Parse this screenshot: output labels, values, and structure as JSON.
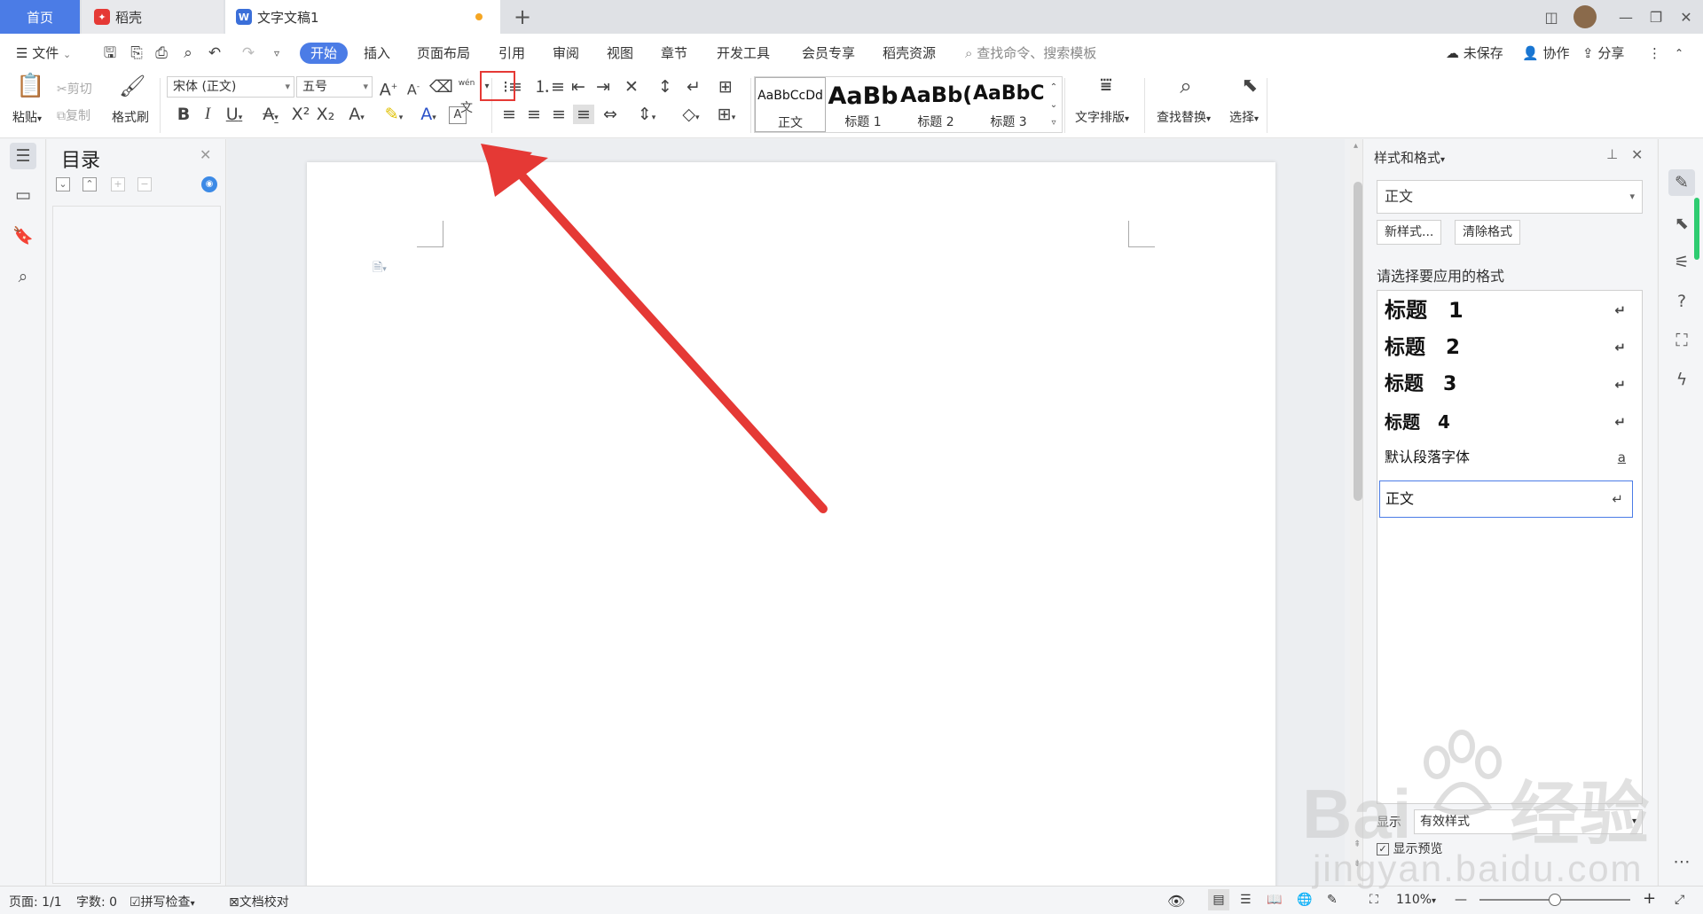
{
  "tabs": {
    "home": "首页",
    "daoke": "稻壳",
    "doc": "文字文稿1"
  },
  "menu": {
    "file": "文件",
    "items": [
      "开始",
      "插入",
      "页面布局",
      "引用",
      "审阅",
      "视图",
      "章节",
      "开发工具",
      "会员专享",
      "稻壳资源"
    ],
    "search": "查找命令、搜索模板",
    "unsaved": "未保存",
    "collab": "协作",
    "share": "分享"
  },
  "ribbon": {
    "paste": "粘贴",
    "cut": "剪切",
    "copy": "复制",
    "format_painter": "格式刷",
    "font_name": "宋体 (正文)",
    "font_size": "五号",
    "styles": [
      {
        "sample": "AaBbCcDd",
        "name": "正文"
      },
      {
        "sample": "AaBb",
        "name": "标题 1"
      },
      {
        "sample": "AaBb(",
        "name": "标题 2"
      },
      {
        "sample": "AaBbC(",
        "name": "标题 3"
      }
    ],
    "text_layout": "文字排版",
    "find_replace": "查找替换",
    "select": "选择"
  },
  "toc": {
    "title": "目录"
  },
  "styles_panel": {
    "header": "样式和格式",
    "current": "正文",
    "new_style": "新样式...",
    "clear_format": "清除格式",
    "prompt": "请选择要应用的格式",
    "items": [
      {
        "label": "标题　1",
        "mark": "↵"
      },
      {
        "label": "标题　2",
        "mark": "↵"
      },
      {
        "label": "标题　3",
        "mark": "↵"
      },
      {
        "label": "标题　4",
        "mark": "↵"
      },
      {
        "label": "默认段落字体",
        "mark": "a"
      },
      {
        "label": "正文",
        "mark": "↵"
      }
    ],
    "show_label": "显示",
    "show_value": "有效样式",
    "preview": "显示预览"
  },
  "status": {
    "page": "页面: 1/1",
    "words": "字数: 0",
    "spell": "拼写检查",
    "proof": "文档校对",
    "zoom": "110%"
  },
  "watermark": {
    "brand": "Bai",
    "brand2": "经验",
    "url": "jingyan.baidu.com"
  },
  "colors": {
    "accent": "#4b7ce6",
    "annotation": "#e53935"
  }
}
